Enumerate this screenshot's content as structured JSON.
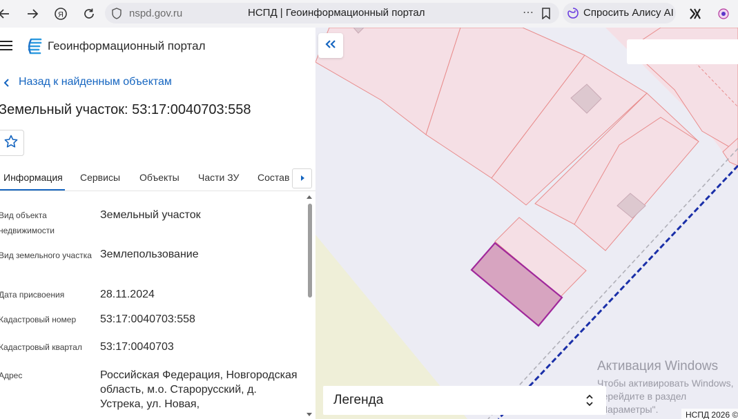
{
  "browser": {
    "url": "nspd.gov.ru",
    "page_title": "НСПД | Геоинформационный портал",
    "ask_alice_label": "Спросить Алису AI"
  },
  "header": {
    "portal_name": "Геоинформационный портал"
  },
  "object": {
    "back_label": "Назад к найденным объектам",
    "title": "Земельный участок: 53:17:0040703:558"
  },
  "tabs": [
    {
      "label": "Информация",
      "active": true
    },
    {
      "label": "Сервисы"
    },
    {
      "label": "Объекты"
    },
    {
      "label": "Части ЗУ"
    },
    {
      "label": "Состав"
    }
  ],
  "properties": [
    {
      "label": "Вид объекта недвижимости",
      "value": "Земельный участок"
    },
    {
      "label": "Вид земельного участка",
      "value": "Землепользование"
    },
    {
      "label": "Дата присвоения",
      "value": "28.11.2024"
    },
    {
      "label": "Кадастровый номер",
      "value": "53:17:0040703:558"
    },
    {
      "label": "Кадастровый квартал",
      "value": "53:17:0040703"
    },
    {
      "label": "Адрес",
      "value": "Российская Федерация, Новгородская область, м.о. Старорусский, д. Устрека, ул. Новая,"
    }
  ],
  "map": {
    "legend_label": "Легенда",
    "copyright": "НСПД 2026 ©",
    "activation_title": "Активация Windows",
    "activation_text": "Чтобы активировать Windows, перейдите в раздел \"Параметры\".",
    "colors": {
      "parcel_line": "#e88c8c",
      "parcel_fill": "#f5dfe5",
      "selected_stroke": "#a0289b",
      "selected_fill": "#d7a4c0",
      "boundary_line": "#1a2fa8",
      "field": "#efefd8"
    }
  }
}
